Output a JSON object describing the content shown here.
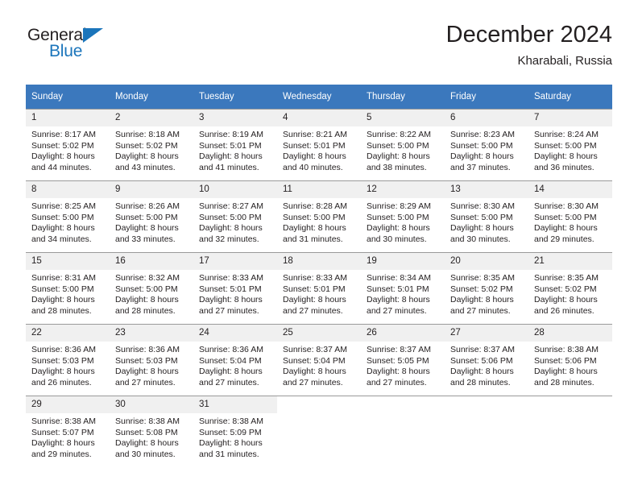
{
  "brand": {
    "name_part1": "General",
    "name_part2": "Blue",
    "accent_color": "#1b75bb"
  },
  "header": {
    "title": "December 2024",
    "location": "Kharabali, Russia"
  },
  "calendar": {
    "header_color": "#3b78bd",
    "weekday_headers": [
      "Sunday",
      "Monday",
      "Tuesday",
      "Wednesday",
      "Thursday",
      "Friday",
      "Saturday"
    ],
    "weeks": [
      [
        {
          "day": "1",
          "sunrise": "Sunrise: 8:17 AM",
          "sunset": "Sunset: 5:02 PM",
          "daylight": "Daylight: 8 hours and 44 minutes."
        },
        {
          "day": "2",
          "sunrise": "Sunrise: 8:18 AM",
          "sunset": "Sunset: 5:02 PM",
          "daylight": "Daylight: 8 hours and 43 minutes."
        },
        {
          "day": "3",
          "sunrise": "Sunrise: 8:19 AM",
          "sunset": "Sunset: 5:01 PM",
          "daylight": "Daylight: 8 hours and 41 minutes."
        },
        {
          "day": "4",
          "sunrise": "Sunrise: 8:21 AM",
          "sunset": "Sunset: 5:01 PM",
          "daylight": "Daylight: 8 hours and 40 minutes."
        },
        {
          "day": "5",
          "sunrise": "Sunrise: 8:22 AM",
          "sunset": "Sunset: 5:00 PM",
          "daylight": "Daylight: 8 hours and 38 minutes."
        },
        {
          "day": "6",
          "sunrise": "Sunrise: 8:23 AM",
          "sunset": "Sunset: 5:00 PM",
          "daylight": "Daylight: 8 hours and 37 minutes."
        },
        {
          "day": "7",
          "sunrise": "Sunrise: 8:24 AM",
          "sunset": "Sunset: 5:00 PM",
          "daylight": "Daylight: 8 hours and 36 minutes."
        }
      ],
      [
        {
          "day": "8",
          "sunrise": "Sunrise: 8:25 AM",
          "sunset": "Sunset: 5:00 PM",
          "daylight": "Daylight: 8 hours and 34 minutes."
        },
        {
          "day": "9",
          "sunrise": "Sunrise: 8:26 AM",
          "sunset": "Sunset: 5:00 PM",
          "daylight": "Daylight: 8 hours and 33 minutes."
        },
        {
          "day": "10",
          "sunrise": "Sunrise: 8:27 AM",
          "sunset": "Sunset: 5:00 PM",
          "daylight": "Daylight: 8 hours and 32 minutes."
        },
        {
          "day": "11",
          "sunrise": "Sunrise: 8:28 AM",
          "sunset": "Sunset: 5:00 PM",
          "daylight": "Daylight: 8 hours and 31 minutes."
        },
        {
          "day": "12",
          "sunrise": "Sunrise: 8:29 AM",
          "sunset": "Sunset: 5:00 PM",
          "daylight": "Daylight: 8 hours and 30 minutes."
        },
        {
          "day": "13",
          "sunrise": "Sunrise: 8:30 AM",
          "sunset": "Sunset: 5:00 PM",
          "daylight": "Daylight: 8 hours and 30 minutes."
        },
        {
          "day": "14",
          "sunrise": "Sunrise: 8:30 AM",
          "sunset": "Sunset: 5:00 PM",
          "daylight": "Daylight: 8 hours and 29 minutes."
        }
      ],
      [
        {
          "day": "15",
          "sunrise": "Sunrise: 8:31 AM",
          "sunset": "Sunset: 5:00 PM",
          "daylight": "Daylight: 8 hours and 28 minutes."
        },
        {
          "day": "16",
          "sunrise": "Sunrise: 8:32 AM",
          "sunset": "Sunset: 5:00 PM",
          "daylight": "Daylight: 8 hours and 28 minutes."
        },
        {
          "day": "17",
          "sunrise": "Sunrise: 8:33 AM",
          "sunset": "Sunset: 5:01 PM",
          "daylight": "Daylight: 8 hours and 27 minutes."
        },
        {
          "day": "18",
          "sunrise": "Sunrise: 8:33 AM",
          "sunset": "Sunset: 5:01 PM",
          "daylight": "Daylight: 8 hours and 27 minutes."
        },
        {
          "day": "19",
          "sunrise": "Sunrise: 8:34 AM",
          "sunset": "Sunset: 5:01 PM",
          "daylight": "Daylight: 8 hours and 27 minutes."
        },
        {
          "day": "20",
          "sunrise": "Sunrise: 8:35 AM",
          "sunset": "Sunset: 5:02 PM",
          "daylight": "Daylight: 8 hours and 27 minutes."
        },
        {
          "day": "21",
          "sunrise": "Sunrise: 8:35 AM",
          "sunset": "Sunset: 5:02 PM",
          "daylight": "Daylight: 8 hours and 26 minutes."
        }
      ],
      [
        {
          "day": "22",
          "sunrise": "Sunrise: 8:36 AM",
          "sunset": "Sunset: 5:03 PM",
          "daylight": "Daylight: 8 hours and 26 minutes."
        },
        {
          "day": "23",
          "sunrise": "Sunrise: 8:36 AM",
          "sunset": "Sunset: 5:03 PM",
          "daylight": "Daylight: 8 hours and 27 minutes."
        },
        {
          "day": "24",
          "sunrise": "Sunrise: 8:36 AM",
          "sunset": "Sunset: 5:04 PM",
          "daylight": "Daylight: 8 hours and 27 minutes."
        },
        {
          "day": "25",
          "sunrise": "Sunrise: 8:37 AM",
          "sunset": "Sunset: 5:04 PM",
          "daylight": "Daylight: 8 hours and 27 minutes."
        },
        {
          "day": "26",
          "sunrise": "Sunrise: 8:37 AM",
          "sunset": "Sunset: 5:05 PM",
          "daylight": "Daylight: 8 hours and 27 minutes."
        },
        {
          "day": "27",
          "sunrise": "Sunrise: 8:37 AM",
          "sunset": "Sunset: 5:06 PM",
          "daylight": "Daylight: 8 hours and 28 minutes."
        },
        {
          "day": "28",
          "sunrise": "Sunrise: 8:38 AM",
          "sunset": "Sunset: 5:06 PM",
          "daylight": "Daylight: 8 hours and 28 minutes."
        }
      ],
      [
        {
          "day": "29",
          "sunrise": "Sunrise: 8:38 AM",
          "sunset": "Sunset: 5:07 PM",
          "daylight": "Daylight: 8 hours and 29 minutes."
        },
        {
          "day": "30",
          "sunrise": "Sunrise: 8:38 AM",
          "sunset": "Sunset: 5:08 PM",
          "daylight": "Daylight: 8 hours and 30 minutes."
        },
        {
          "day": "31",
          "sunrise": "Sunrise: 8:38 AM",
          "sunset": "Sunset: 5:09 PM",
          "daylight": "Daylight: 8 hours and 31 minutes."
        },
        {
          "day": "",
          "sunrise": "",
          "sunset": "",
          "daylight": ""
        },
        {
          "day": "",
          "sunrise": "",
          "sunset": "",
          "daylight": ""
        },
        {
          "day": "",
          "sunrise": "",
          "sunset": "",
          "daylight": ""
        },
        {
          "day": "",
          "sunrise": "",
          "sunset": "",
          "daylight": ""
        }
      ]
    ]
  }
}
